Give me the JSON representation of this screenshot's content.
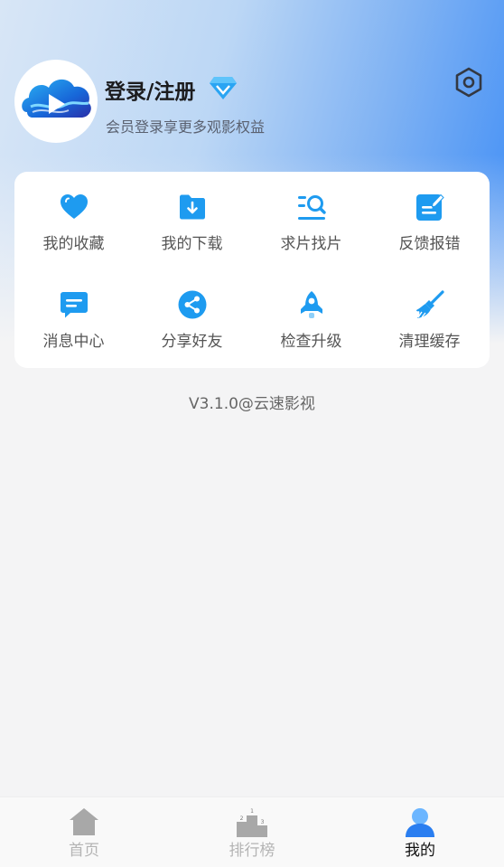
{
  "profile": {
    "login_label": "登录/注册",
    "subtitle": "会员登录享更多观影权益",
    "avatar_icon": "cloud-play-logo",
    "vip_icon": "diamond-icon",
    "settings_icon": "hexagon-gear-icon"
  },
  "grid": {
    "items": [
      {
        "label": "我的收藏",
        "icon": "heart-icon"
      },
      {
        "label": "我的下载",
        "icon": "download-folder-icon"
      },
      {
        "label": "求片找片",
        "icon": "search-list-icon"
      },
      {
        "label": "反馈报错",
        "icon": "edit-note-icon"
      },
      {
        "label": "消息中心",
        "icon": "message-icon"
      },
      {
        "label": "分享好友",
        "icon": "share-icon"
      },
      {
        "label": "检查升级",
        "icon": "rocket-icon"
      },
      {
        "label": "清理缓存",
        "icon": "broom-icon"
      }
    ]
  },
  "version": "V3.1.0@云速影视",
  "tabbar": {
    "tabs": [
      {
        "label": "首页",
        "icon": "home-icon",
        "active": false
      },
      {
        "label": "排行榜",
        "icon": "podium-icon",
        "active": false
      },
      {
        "label": "我的",
        "icon": "user-icon",
        "active": true
      }
    ]
  },
  "colors": {
    "accent": "#1e9bf0",
    "header_gradient_end": "#3d8cf6",
    "inactive_tab": "#a8a8a8"
  }
}
